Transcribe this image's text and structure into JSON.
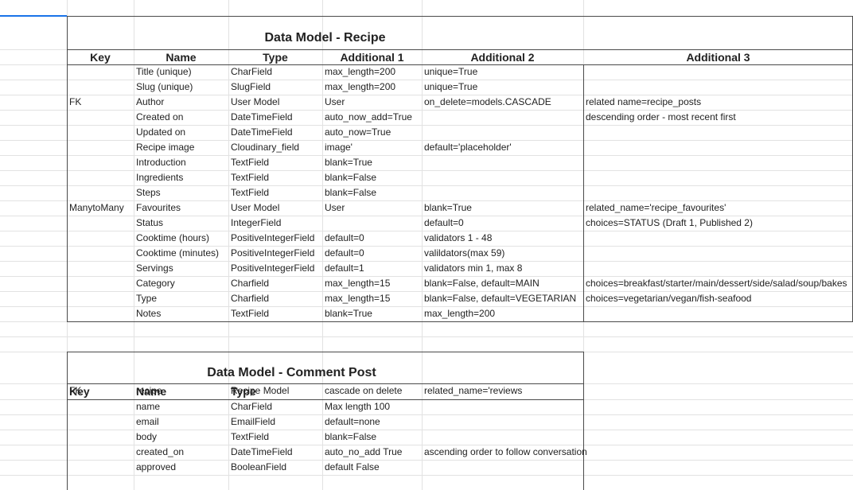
{
  "recipe": {
    "title": "Data Model - Recipe",
    "headers": [
      "Key",
      "Name",
      "Type",
      "Additional 1",
      "Additional 2",
      "Additional 3"
    ],
    "rows": [
      [
        "",
        "Title (unique)",
        "CharField",
        "max_length=200",
        "unique=True",
        ""
      ],
      [
        "",
        "Slug (unique)",
        "SlugField",
        "max_length=200",
        "unique=True",
        ""
      ],
      [
        "FK",
        "Author",
        "User Model",
        "User",
        "on_delete=models.CASCADE",
        "related name=recipe_posts"
      ],
      [
        "",
        "Created on",
        "DateTimeField",
        "auto_now_add=True",
        "",
        "descending order - most recent first"
      ],
      [
        "",
        "Updated on",
        "DateTimeField",
        "auto_now=True",
        "",
        ""
      ],
      [
        "",
        "Recipe image",
        "Cloudinary_field",
        "image'",
        "default='placeholder'",
        ""
      ],
      [
        "",
        "Introduction",
        "TextField",
        "blank=True",
        "",
        ""
      ],
      [
        "",
        "Ingredients",
        "TextField",
        "blank=False",
        "",
        ""
      ],
      [
        "",
        "Steps",
        "TextField",
        "blank=False",
        "",
        ""
      ],
      [
        "ManytoMany",
        "Favourites",
        "User Model",
        "User",
        "blank=True",
        "related_name='recipe_favourites'"
      ],
      [
        "",
        "Status",
        "IntegerField",
        "",
        "default=0",
        "choices=STATUS (Draft 1, Published 2)"
      ],
      [
        "",
        "Cooktime (hours)",
        "PositiveIntegerField",
        "default=0",
        "validators 1 - 48",
        ""
      ],
      [
        "",
        "Cooktime (minutes)",
        "PositiveIntegerField",
        "default=0",
        "valildators(max 59)",
        ""
      ],
      [
        "",
        "Servings",
        "PositiveIntegerField",
        "default=1",
        "validators min 1,  max 8",
        ""
      ],
      [
        "",
        "Category",
        "Charfield",
        "max_length=15",
        "blank=False, default=MAIN",
        "choices=breakfast/starter/main/dessert/side/salad/soup/bakes"
      ],
      [
        "",
        "Type",
        "Charfield",
        "max_length=15",
        "blank=False, default=VEGETARIAN",
        "choices=vegetarian/vegan/fish-seafood"
      ],
      [
        "",
        "Notes",
        "TextField",
        "blank=True",
        "max_length=200",
        ""
      ]
    ]
  },
  "comment": {
    "title": "Data Model - Comment Post",
    "headers": [
      "Key",
      "Name",
      "Type"
    ],
    "rows": [
      [
        "FK",
        "recipe",
        "Recipe Model",
        "cascade on delete",
        "related_name='reviews"
      ],
      [
        "",
        "name",
        "CharField",
        "Max length 100",
        ""
      ],
      [
        "",
        "email",
        "EmailField",
        "default=none",
        ""
      ],
      [
        "",
        "body",
        "TextField",
        "blank=False",
        ""
      ],
      [
        "",
        "created_on",
        "DateTimeField",
        "auto_no_add True",
        "ascending order to follow conversation"
      ],
      [
        "",
        "approved",
        "BooleanField",
        "default False",
        ""
      ]
    ]
  }
}
